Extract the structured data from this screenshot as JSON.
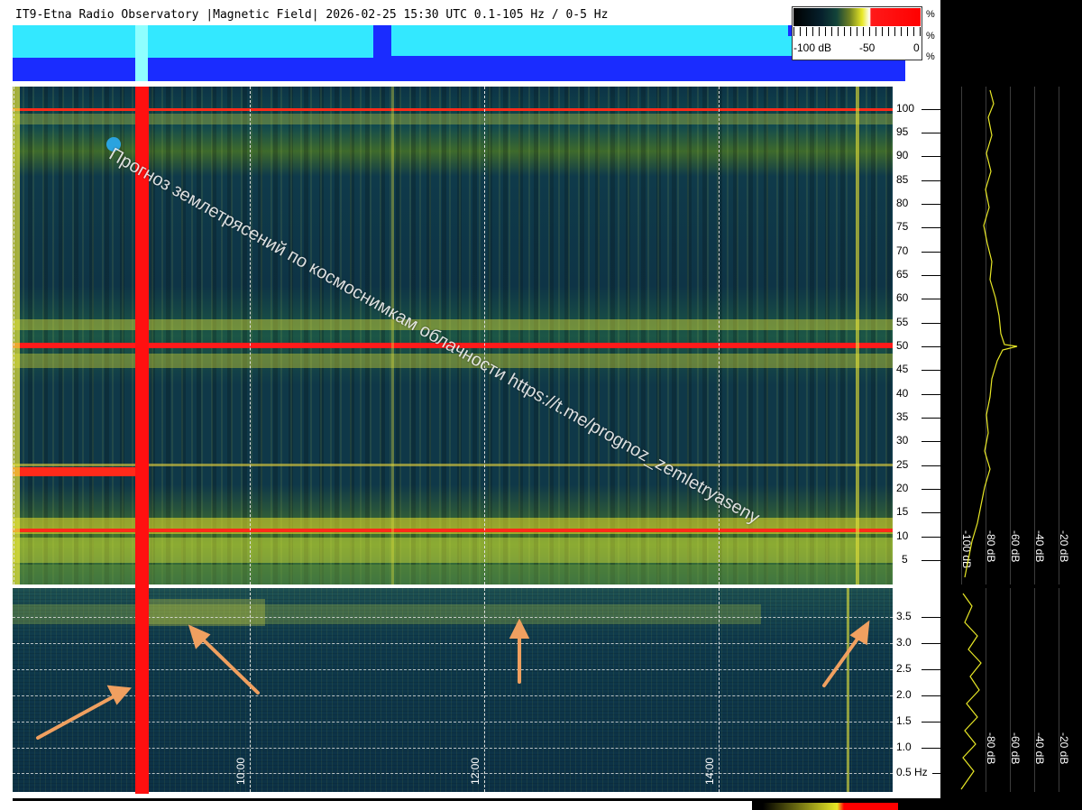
{
  "header": {
    "title": "IT9-Etna Radio Observatory |Magnetic Field| 2026-02-25 15:30 UTC 0.1-105 Hz / 0-5 Hz"
  },
  "color_scale": {
    "labels": [
      "-100 dB",
      "-50",
      "0"
    ],
    "percent_marks": [
      "%",
      "%",
      "%"
    ]
  },
  "main_axis": {
    "freq_labels": [
      "100",
      "95",
      "90",
      "85",
      "80",
      "75",
      "70",
      "65",
      "60",
      "55",
      "50",
      "45",
      "40",
      "35",
      "30",
      "25",
      "20",
      "15",
      "10",
      "5"
    ]
  },
  "low_axis": {
    "freq_labels": [
      "3.5",
      "3.0",
      "2.5",
      "2.0",
      "1.5",
      "1.0",
      "0.5 Hz"
    ]
  },
  "time_axis": {
    "labels": [
      "10:00",
      "12:00",
      "14:00"
    ]
  },
  "side_spectrum": {
    "main_db_labels": [
      "-100 dB",
      "-80 dB",
      "-60 dB",
      "-40 dB",
      "-20 dB"
    ],
    "low_db_labels": [
      "-80 dB",
      "-60 dB",
      "-40 dB",
      "-20 dB"
    ]
  },
  "watermark": {
    "text": "Прогноз землетрясений по космоснимкам облачности https://t.me/prognoz_zemletryaseny"
  },
  "colors": {
    "burst_red": "#ff1010",
    "annotation_arrow": "#f0a060",
    "spectrum_trace": "#e8e826",
    "telegram_blue": "#2aa3df"
  }
}
